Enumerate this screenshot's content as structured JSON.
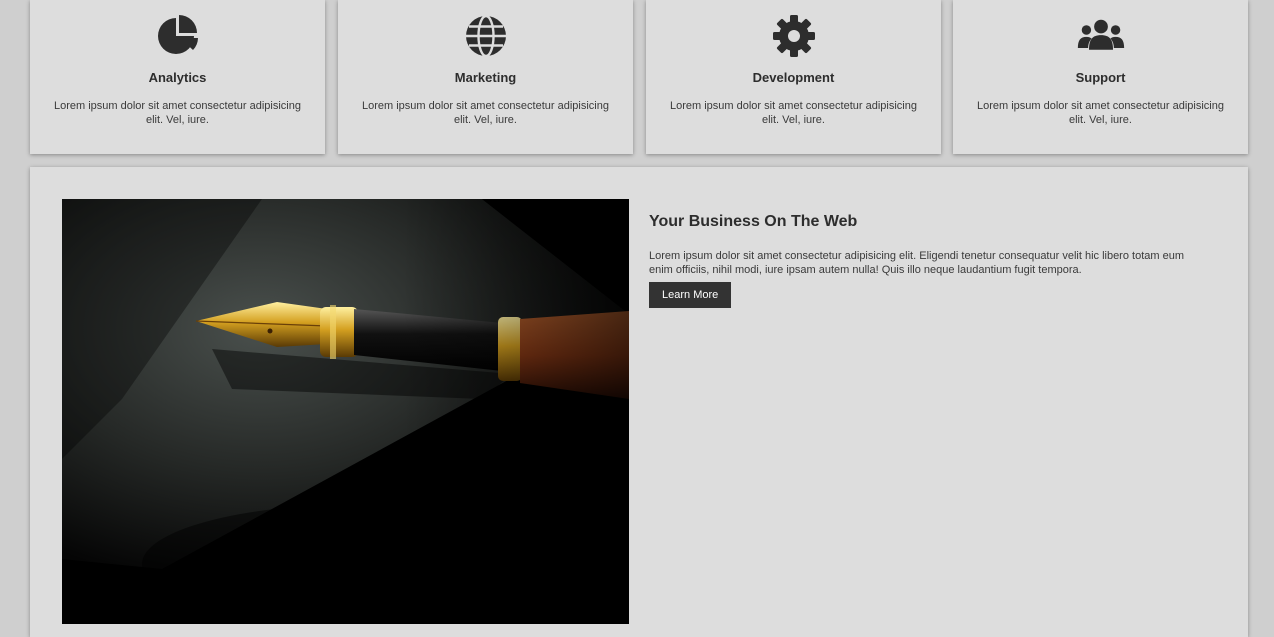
{
  "features": [
    {
      "title": "Analytics",
      "text": "Lorem ipsum dolor sit amet consectetur adipisicing elit. Vel, iure.",
      "icon": "pie-chart-icon"
    },
    {
      "title": "Marketing",
      "text": "Lorem ipsum dolor sit amet consectetur adipisicing elit. Vel, iure.",
      "icon": "globe-icon"
    },
    {
      "title": "Development",
      "text": "Lorem ipsum dolor sit amet consectetur adipisicing elit. Vel, iure.",
      "icon": "gear-icon"
    },
    {
      "title": "Support",
      "text": "Lorem ipsum dolor sit amet consectetur adipisicing elit. Vel, iure.",
      "icon": "users-icon"
    }
  ],
  "business": {
    "title": "Your Business On The Web",
    "text": "Lorem ipsum dolor sit amet consectetur adipisicing elit. Eligendi tenetur consequatur velit hic libero totam eum enim officiis, nihil modi, iure ipsam autem nulla! Quis illo neque laudantium fugit tempora.",
    "button_label": "Learn More",
    "image": "fountain-pen-photo"
  },
  "colors": {
    "background": "#cfcfcf",
    "card": "#dddddd",
    "icon": "#2d2d2d",
    "button": "#333333"
  }
}
